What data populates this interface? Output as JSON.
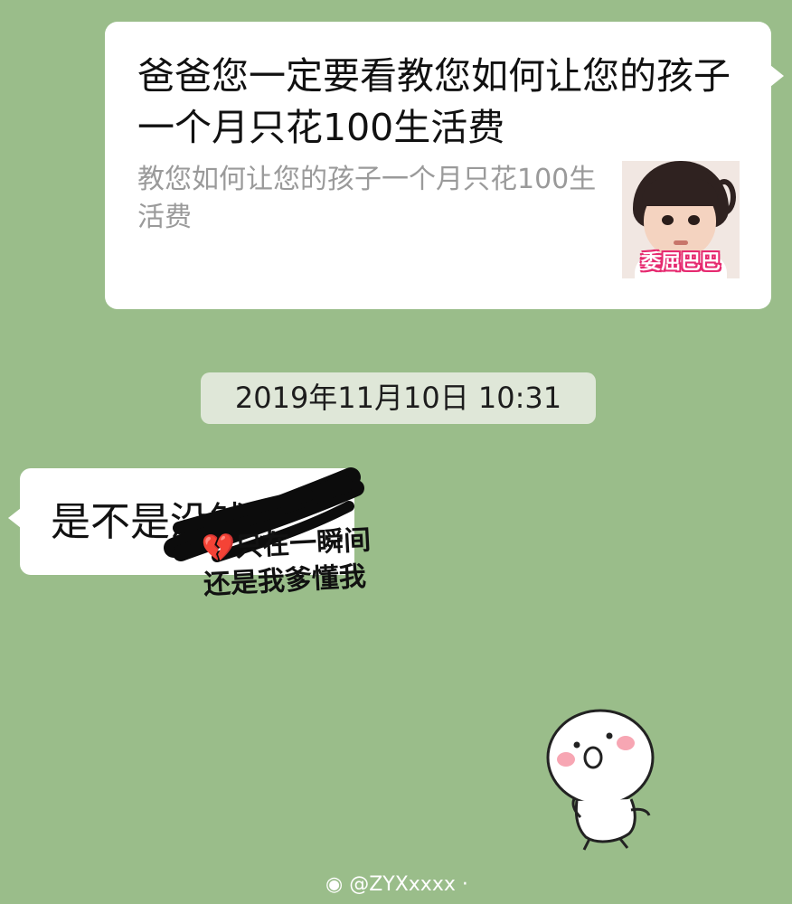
{
  "link_card": {
    "title": "爸爸您一定要看教您如何让您的孩子一个月只花100生活费",
    "description": "教您如何让您的孩子一个月只花100生活费",
    "thumbnail_caption": "委屈巴巴"
  },
  "timestamp": "2019年11月10日 10:31",
  "reply": {
    "text_visible": "是不是没",
    "text_scribbled": "钱了"
  },
  "overlay_caption": {
    "heart_icon": "💔",
    "line1": "只在一瞬间",
    "line2": "还是我爹懂我"
  },
  "watermark": {
    "text": "@ZYXxxxx",
    "icon": "weibo-icon"
  },
  "colors": {
    "chat_background": "#9abd8a",
    "bubble": "#ffffff",
    "timestamp_pill": "#dfe7d8"
  }
}
